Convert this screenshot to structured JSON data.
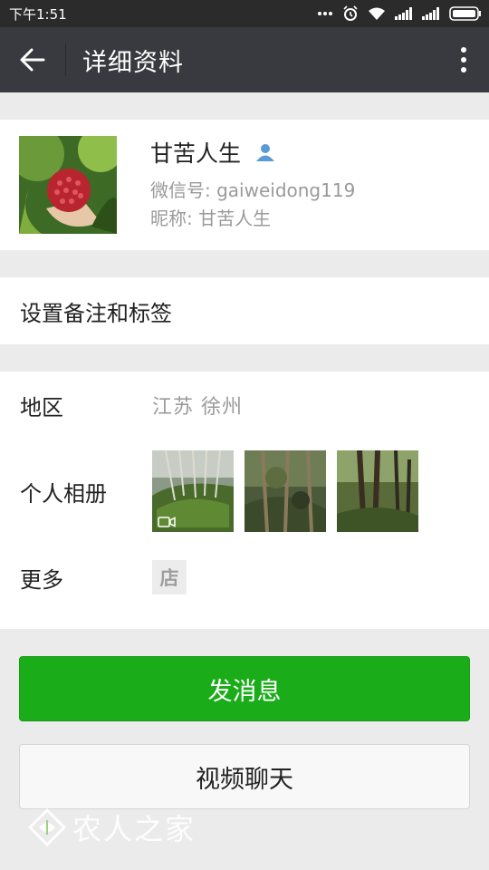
{
  "status_bar": {
    "time": "下午1:51",
    "icons": [
      "more-dots-icon",
      "alarm-icon",
      "wifi-icon",
      "signal-icon",
      "signal-icon",
      "battery-icon"
    ]
  },
  "nav": {
    "back_icon": "arrow-left-icon",
    "title": "详细资料",
    "more_icon": "vertical-dots-icon"
  },
  "profile": {
    "name": "甘苦人生",
    "contact_icon": "person-icon",
    "wechat_id": "微信号: gaiweidong119",
    "nickname": "昵称: 甘苦人生"
  },
  "remark": {
    "label": "设置备注和标签"
  },
  "details": {
    "region_label": "地区",
    "region_value": "江苏  徐州",
    "album_label": "个人相册",
    "album_video_icon": "video-camera-icon",
    "more_label": "更多",
    "shop_label": "店"
  },
  "actions": {
    "send_message": "发消息",
    "video_chat": "视频聊天"
  },
  "watermark": {
    "text": "农人之家"
  },
  "colors": {
    "nav_bg": "#393a3f",
    "primary_green": "#1aad19",
    "page_bg": "#ebebeb",
    "contact_icon_blue": "#5b9bd5"
  }
}
